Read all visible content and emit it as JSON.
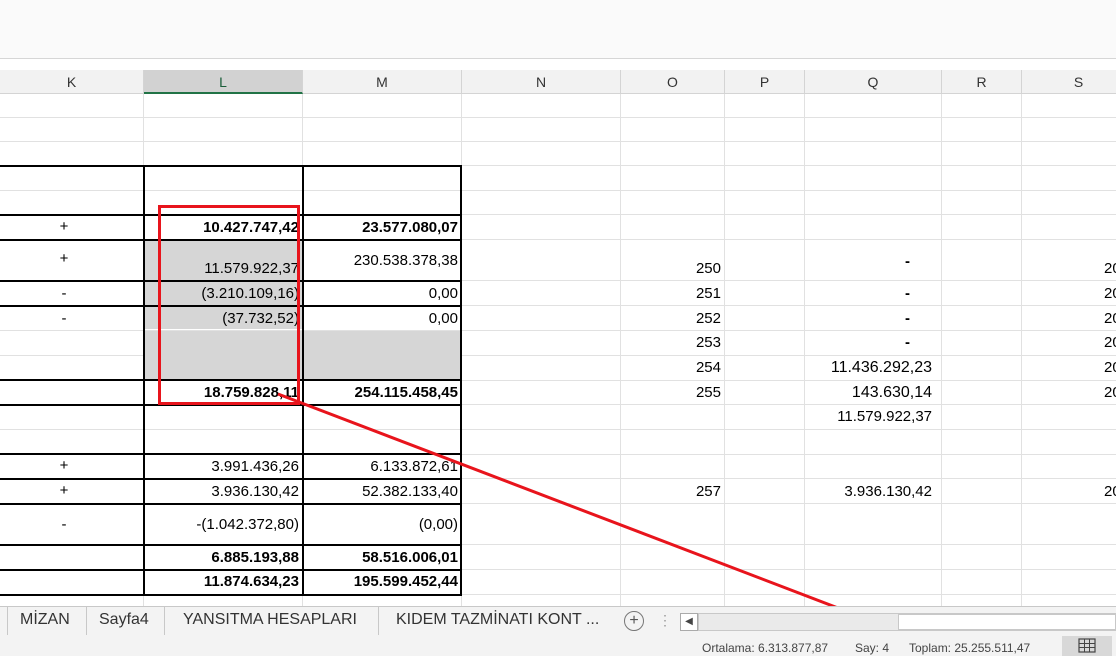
{
  "columns": [
    "K",
    "L",
    "M",
    "N",
    "O",
    "P",
    "Q",
    "R",
    "S"
  ],
  "table": {
    "k_signs": [
      "+",
      "+",
      "-",
      "-",
      "+",
      "+",
      "-"
    ],
    "l_values": [
      "10.427.747,42",
      "11.579.922,37",
      "(3.210.109,16)",
      "(37.732,52)",
      "18.759.828,11",
      "3.991.436,26",
      "3.936.130,42",
      "-(1.042.372,80)",
      "6.885.193,88",
      "11.874.634,23"
    ],
    "m_values": [
      "23.577.080,07",
      "230.538.378,38",
      "0,00",
      "0,00",
      "254.115.458,45",
      "6.133.872,61",
      "52.382.133,40",
      "(0,00)",
      "58.516.006,01",
      "195.599.452,44"
    ]
  },
  "side": {
    "o_values": [
      "250",
      "251",
      "252",
      "253",
      "254",
      "255",
      "257"
    ],
    "q_values": [
      "-",
      "-",
      "-",
      "-",
      "11.436.292,23",
      "143.630,14",
      "11.579.922,37",
      "3.936.130,42"
    ],
    "s_values": [
      "20",
      "20",
      "20",
      "20",
      "20",
      "20",
      "20"
    ]
  },
  "sheet_tabs": [
    "MİZAN",
    "Sayfa4",
    "YANSITMA HESAPLARI",
    "KIDEM TAZMİNATI KONT ..."
  ],
  "status_bar": {
    "average": "Ortalama: 6.313.877,87",
    "count": "Say: 4",
    "sum": "Toplam: 25.255.511,47"
  },
  "colors": {
    "highlight": "#e8141c",
    "shade": "#d6d6d6",
    "accent": "#217346"
  }
}
